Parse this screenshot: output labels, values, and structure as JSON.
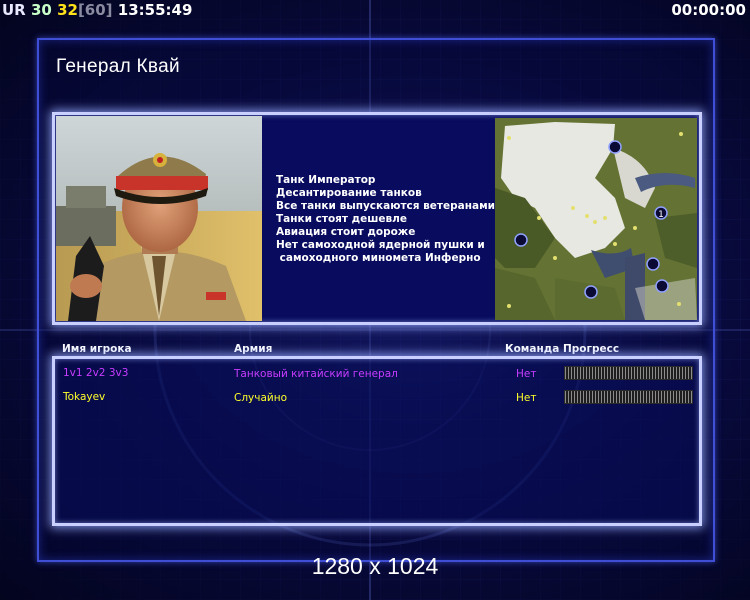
{
  "hud": {
    "ur_label": "UR",
    "fps": "30",
    "current": "32",
    "cap": "[60]",
    "clock": "13:55:49",
    "game_timer": "00:00:00"
  },
  "title": "Генерал Квай",
  "bonuses": [
    "Танк Император",
    "Десантирование танков",
    "Все танки выпускаются ветеранами",
    "Танки стоят дешевле",
    "Авиация стоит дороже",
    "Нет самоходной ядерной пушки и",
    " самоходного миномета Инферно"
  ],
  "minimap": {
    "start_marker_label": "1"
  },
  "columns": {
    "player": "Имя игрока",
    "army": "Армия",
    "team": "Команда",
    "progress": "Прогресс"
  },
  "players": [
    {
      "name": "1v1 2v2 3v3",
      "army": "Танковый китайский генерал",
      "team": "Нет",
      "color": "#c83cff"
    },
    {
      "name": "Tokayev",
      "army": "Случайно",
      "team": "Нет",
      "color": "#ffff2a"
    }
  ],
  "resolution": "1280 x 1024",
  "colors": {
    "frame_border": "#3e4fd6",
    "panel_border": "#c9d0ff",
    "timer_current": "#ffe21a"
  }
}
